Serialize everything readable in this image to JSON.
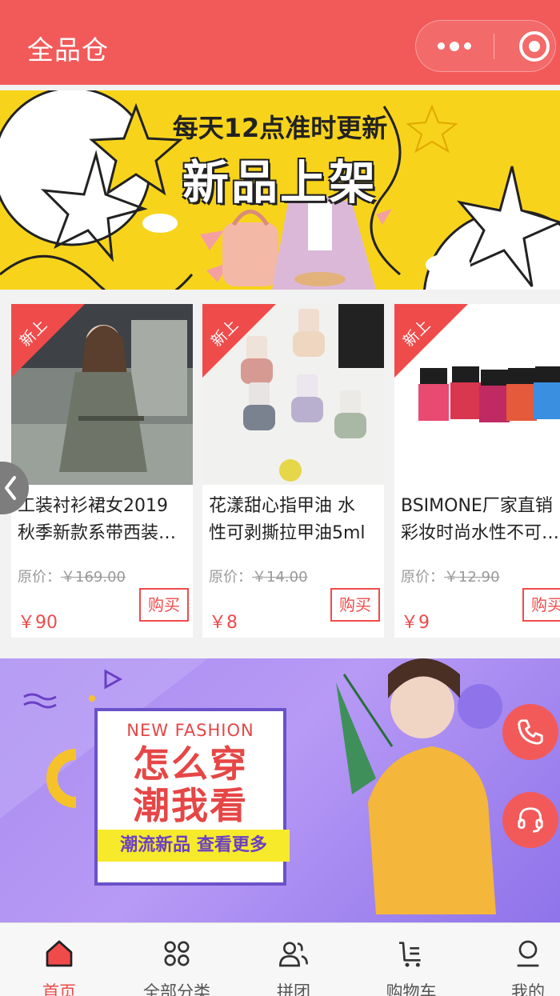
{
  "header": {
    "title": "全品仓"
  },
  "banner_top": {
    "subtitle": "每天12点准时更新",
    "headline": "新品上架"
  },
  "products": [
    {
      "tag": "新上",
      "name_line1": "工装衬衫裙女2019",
      "name_line2": "秋季新款系带西装…",
      "orig_label": "原价：",
      "orig_price": "￥169.00",
      "price": "￥90",
      "buy": "购买"
    },
    {
      "tag": "新上",
      "name_line1": "花漾甜心指甲油 水",
      "name_line2": "性可剥撕拉甲油5ml",
      "orig_label": "原价：",
      "orig_price": "￥14.00",
      "price": "￥8",
      "buy": "购买"
    },
    {
      "tag": "新上",
      "name_line1": "BSIMONE厂家直销",
      "name_line2": "彩妆时尚水性不可…",
      "orig_label": "原价：",
      "orig_price": "￥12.90",
      "price": "￥9",
      "buy": "购买"
    }
  ],
  "banner_bottom": {
    "en": "NEW  FASHION",
    "line1": "怎么穿",
    "line2": "潮我看",
    "ribbon": "潮流新品 查看更多"
  },
  "tabbar": [
    {
      "label": "首页",
      "icon": "home-icon",
      "active": true
    },
    {
      "label": "全部分类",
      "icon": "grid-icon",
      "active": false
    },
    {
      "label": "拼团",
      "icon": "group-icon",
      "active": false
    },
    {
      "label": "购物车",
      "icon": "cart-icon",
      "active": false
    },
    {
      "label": "我的",
      "icon": "user-icon",
      "active": false
    }
  ],
  "colors": {
    "brand": "#f25a5a",
    "price": "#f04b4b",
    "banner_yellow": "#f7d41b"
  }
}
